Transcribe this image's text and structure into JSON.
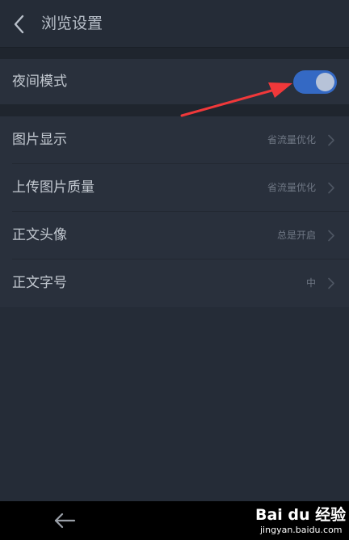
{
  "header": {
    "title": "浏览设置",
    "back_icon": "chevron-left-icon"
  },
  "night_mode": {
    "label": "夜间模式",
    "enabled": true
  },
  "settings": {
    "items": [
      {
        "label": "图片显示",
        "value": "省流量优化"
      },
      {
        "label": "上传图片质量",
        "value": "省流量优化"
      },
      {
        "label": "正文头像",
        "value": "总是开启"
      },
      {
        "label": "正文字号",
        "value": "中"
      }
    ]
  },
  "annotation": {
    "arrow_color": "#f0383a"
  },
  "watermark": {
    "brand": "Bai du 经验",
    "url": "jingyan.baidu.com"
  },
  "colors": {
    "toggle_on": "#3469c4",
    "background": "#252c37",
    "row_bg": "#29303c"
  }
}
